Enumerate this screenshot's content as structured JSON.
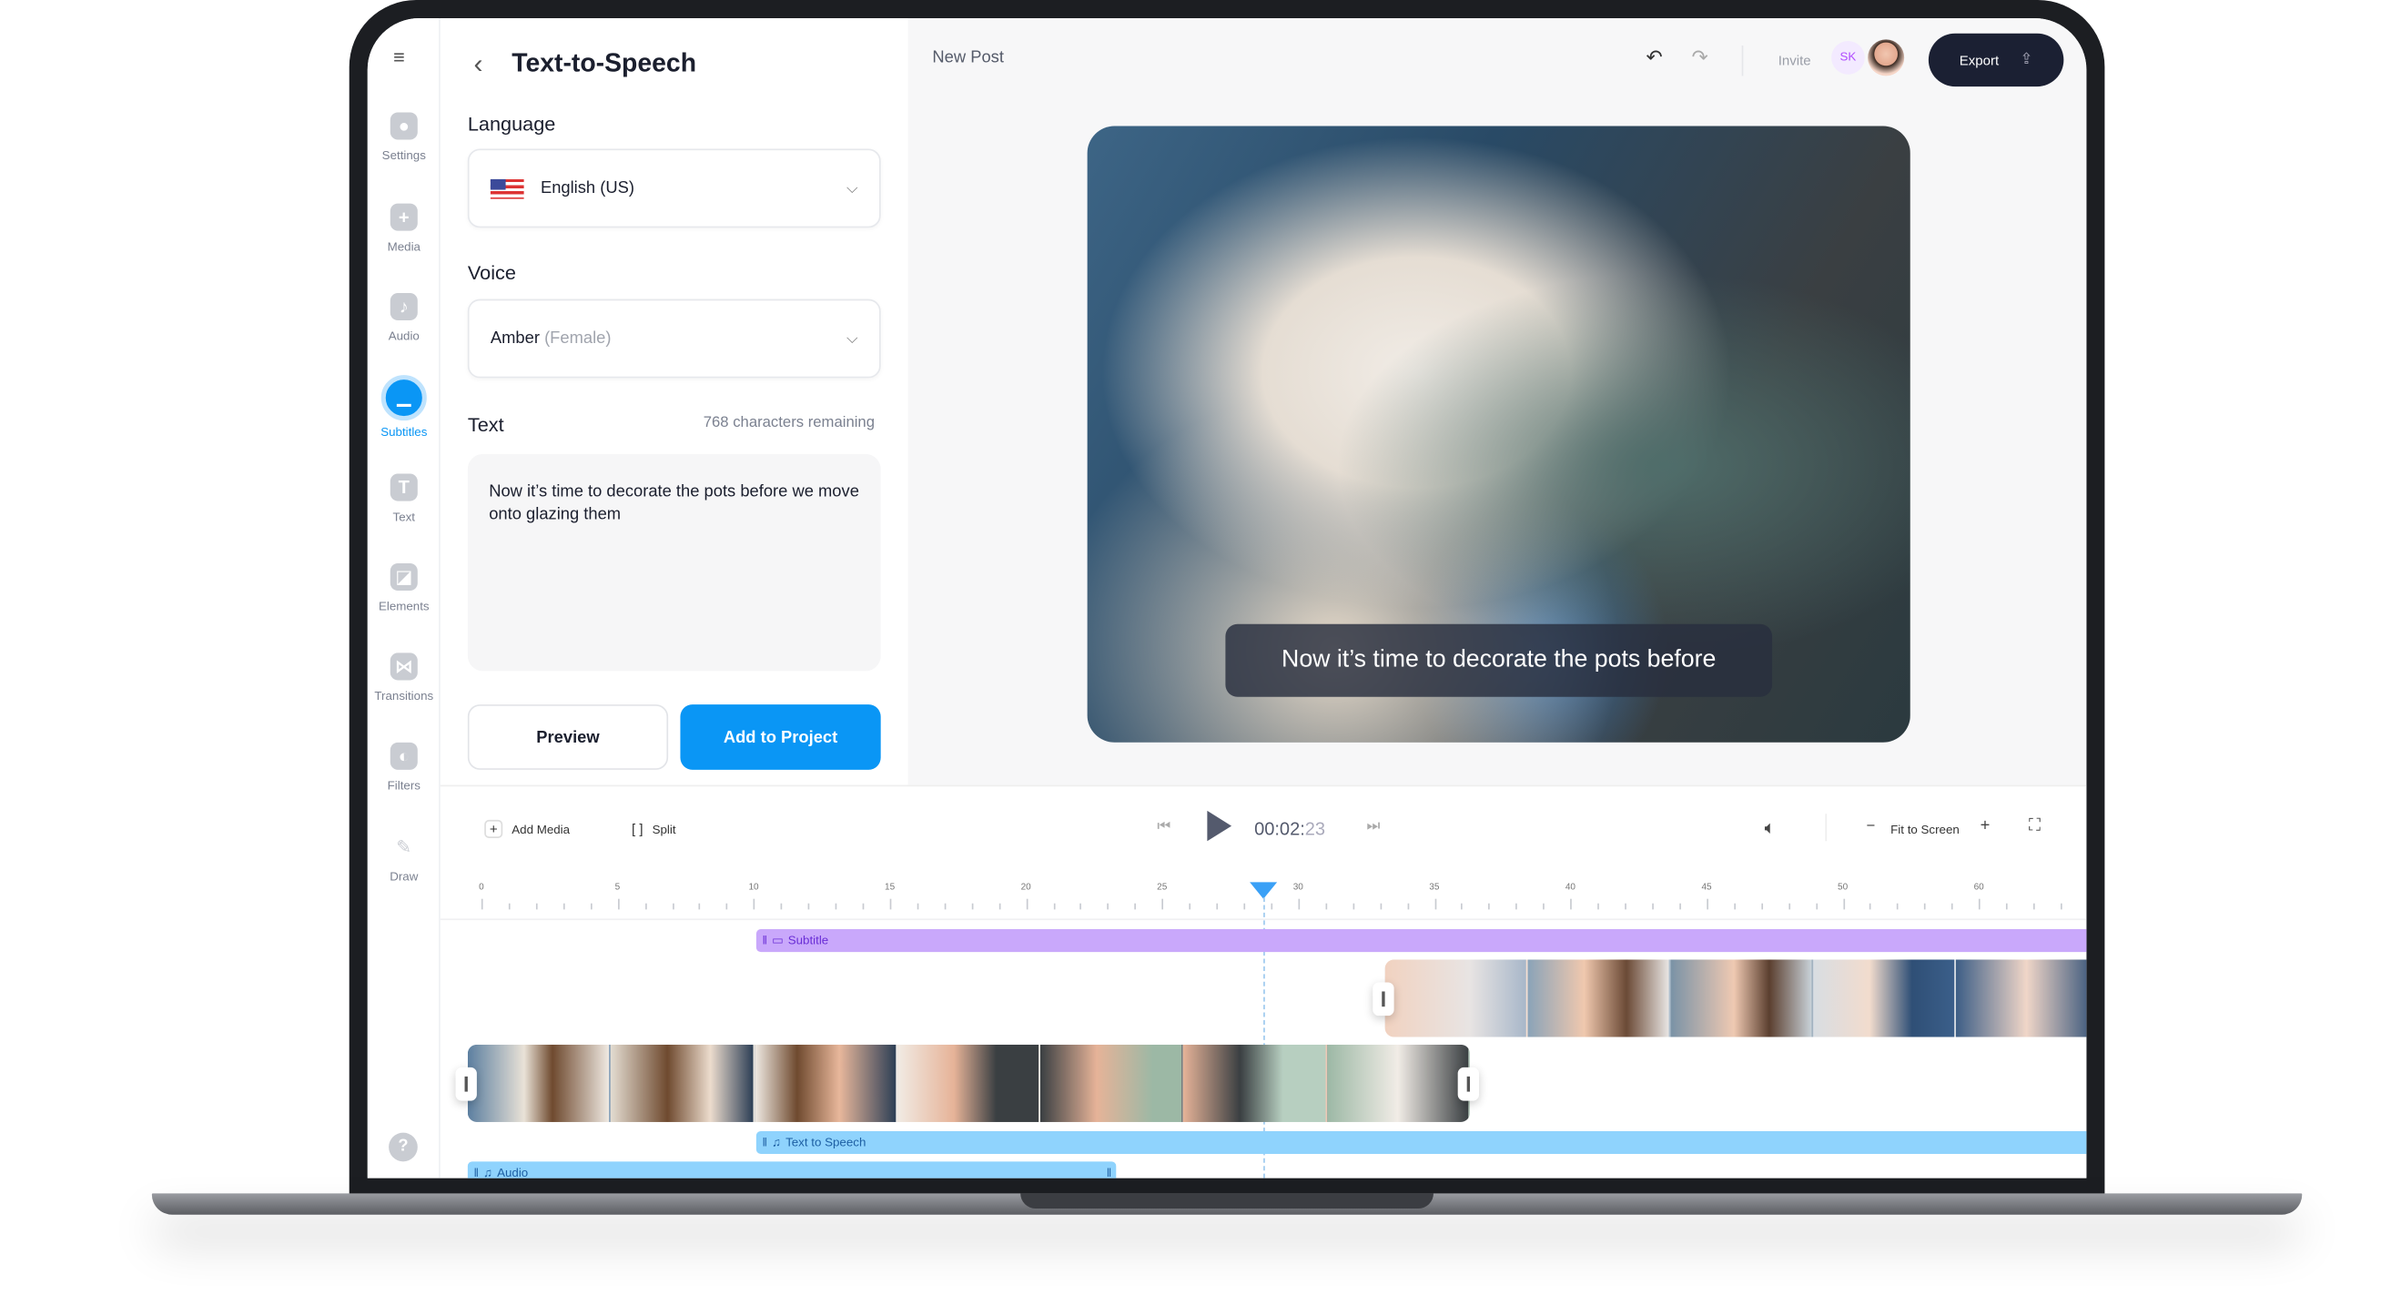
{
  "sidebar": {
    "items": [
      {
        "label": "Settings",
        "icon": "settings-icon"
      },
      {
        "label": "Media",
        "icon": "plus-icon"
      },
      {
        "label": "Audio",
        "icon": "music-icon"
      },
      {
        "label": "Subtitles",
        "icon": "subtitles-icon",
        "active": true
      },
      {
        "label": "Text",
        "icon": "text-icon"
      },
      {
        "label": "Elements",
        "icon": "elements-icon"
      },
      {
        "label": "Transitions",
        "icon": "transitions-icon"
      },
      {
        "label": "Filters",
        "icon": "filters-icon"
      },
      {
        "label": "Draw",
        "icon": "pencil-icon"
      }
    ],
    "help": "?"
  },
  "panel": {
    "title": "Text-to-Speech",
    "language_label": "Language",
    "language_value": "English (US)",
    "voice_label": "Voice",
    "voice_name": "Amber",
    "voice_gender": "(Female)",
    "text_label": "Text",
    "chars_remaining": "768 characters remaining",
    "text_value": "Now it’s time to decorate the pots before we move onto glazing them",
    "preview_label": "Preview",
    "add_label": "Add to Project"
  },
  "header": {
    "title": "New Post",
    "invite": "Invite",
    "avatar_initials": "SK",
    "export": "Export"
  },
  "video": {
    "caption": "Now it’s time to decorate the pots before"
  },
  "timeline": {
    "add_media": "Add Media",
    "split": "Split",
    "time_main": "00:02:",
    "time_frames": "23",
    "fit": "Fit to Screen",
    "ruler": [
      "0",
      "5",
      "10",
      "15",
      "20",
      "25",
      "30",
      "35",
      "40",
      "45",
      "50",
      "60"
    ],
    "playhead": 28.7,
    "tracks": {
      "subtitle": "Subtitle",
      "tts": "Text to Speech",
      "audio": "Audio"
    }
  },
  "colors": {
    "accent": "#0a96f5",
    "export_bg": "#1b2033",
    "subtitle_track": "#c9a8fb",
    "audio_track": "#8fd3fd"
  }
}
